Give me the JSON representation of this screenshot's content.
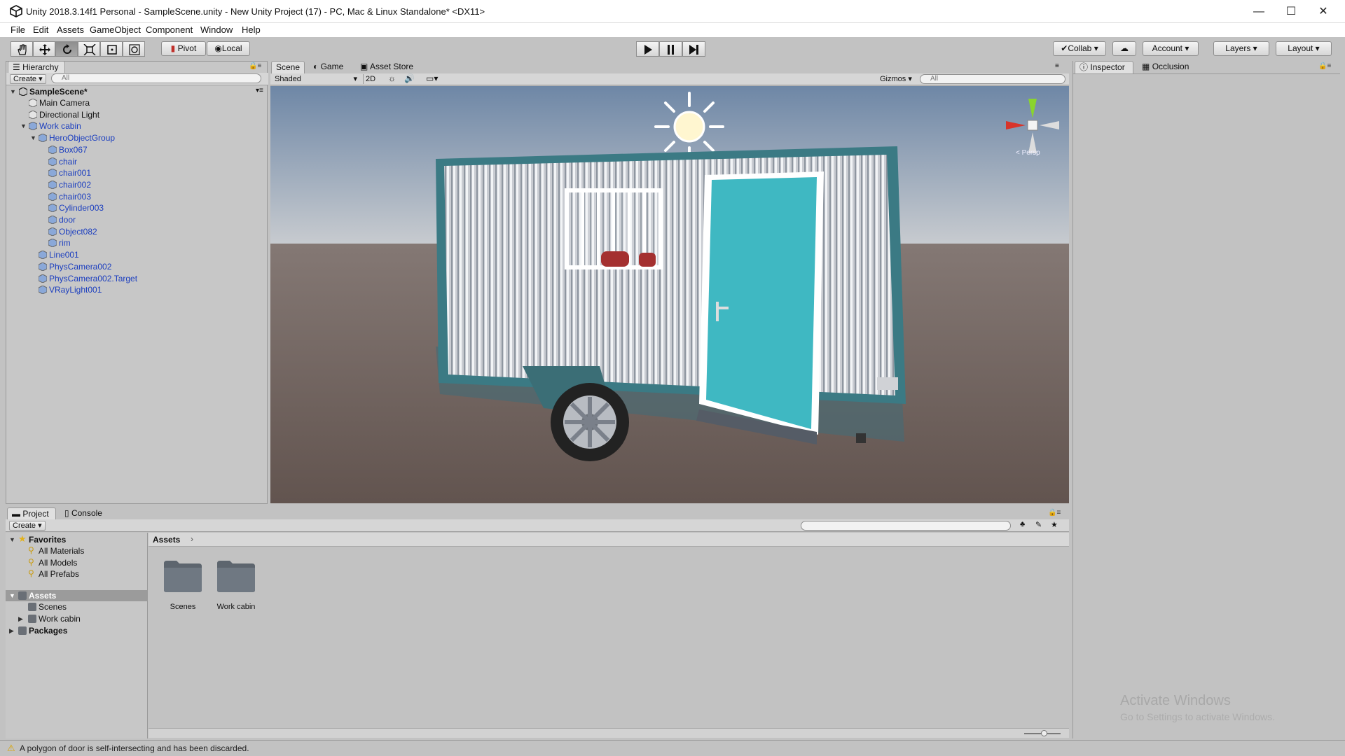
{
  "window": {
    "title": "Unity 2018.3.14f1 Personal - SampleScene.unity - New Unity Project (17) - PC, Mac & Linux Standalone* <DX11>",
    "minimize": "—",
    "maximize": "☐",
    "close": "✕"
  },
  "menu": [
    "File",
    "Edit",
    "Assets",
    "GameObject",
    "Component",
    "Window",
    "Help"
  ],
  "toolbar": {
    "pivot": "Pivot",
    "local": "Local",
    "collab": "Collab",
    "account": "Account",
    "layers": "Layers",
    "layout": "Layout"
  },
  "hierarchy": {
    "tab": "Hierarchy",
    "create": "Create",
    "search_placeholder": "All",
    "scene": "SampleScene*",
    "items": [
      {
        "label": "Main Camera",
        "depth": 0,
        "blue": false
      },
      {
        "label": "Directional Light",
        "depth": 0,
        "blue": false
      },
      {
        "label": "Work cabin",
        "depth": 0,
        "blue": true,
        "expanded": true
      },
      {
        "label": "HeroObjectGroup",
        "depth": 1,
        "blue": true,
        "expanded": true
      },
      {
        "label": "Box067",
        "depth": 2,
        "blue": true
      },
      {
        "label": "chair",
        "depth": 2,
        "blue": true
      },
      {
        "label": "chair001",
        "depth": 2,
        "blue": true
      },
      {
        "label": "chair002",
        "depth": 2,
        "blue": true
      },
      {
        "label": "chair003",
        "depth": 2,
        "blue": true
      },
      {
        "label": "Cylinder003",
        "depth": 2,
        "blue": true
      },
      {
        "label": "door",
        "depth": 2,
        "blue": true
      },
      {
        "label": "Object082",
        "depth": 2,
        "blue": true
      },
      {
        "label": "rim",
        "depth": 2,
        "blue": true
      },
      {
        "label": "Line001",
        "depth": 1,
        "blue": true
      },
      {
        "label": "PhysCamera002",
        "depth": 1,
        "blue": true
      },
      {
        "label": "PhysCamera002.Target",
        "depth": 1,
        "blue": true
      },
      {
        "label": "VRayLight001",
        "depth": 1,
        "blue": true
      }
    ]
  },
  "scene_tabs": {
    "scene": "Scene",
    "game": "Game",
    "asset_store": "Asset Store"
  },
  "scene_bar": {
    "shading": "Shaded",
    "mode2d": "2D",
    "gizmos": "Gizmos",
    "search_placeholder": "All"
  },
  "scene_gizmo": {
    "persp": "< Persp"
  },
  "inspector": {
    "tab": "Inspector",
    "occlusion": "Occlusion"
  },
  "project": {
    "tab": "Project",
    "console": "Console",
    "create": "Create",
    "breadcrumb": "Assets",
    "favorites_label": "Favorites",
    "favorites": [
      "All Materials",
      "All Models",
      "All Prefabs"
    ],
    "assets_label": "Assets",
    "assets_children": [
      "Scenes",
      "Work cabin"
    ],
    "packages_label": "Packages",
    "folders": [
      "Scenes",
      "Work cabin"
    ]
  },
  "status": {
    "message": "A polygon of door is self-intersecting and has been discarded."
  },
  "watermark": {
    "line1": "Activate Windows",
    "line2": "Go to Settings to activate Windows."
  },
  "colors": {
    "accent_blue": "#1b3ebf",
    "door_teal": "#3fb8c2",
    "sky_top": "#7b8ea3",
    "ground": "#6a5e58"
  }
}
